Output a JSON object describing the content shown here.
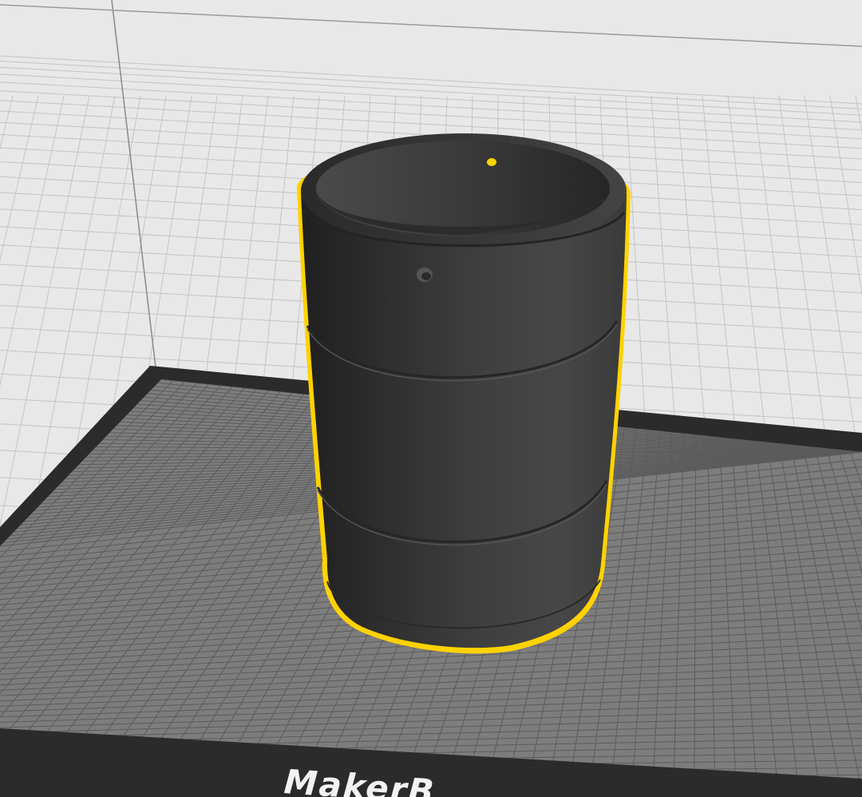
{
  "app": {
    "view": "3d-build-preview"
  },
  "build_plate": {
    "brand_text": "MakerB",
    "surface_color": "#7d7d7d",
    "frame_color": "#2b2b2b",
    "grid_color": "#5c5c5c"
  },
  "environment": {
    "background_color": "#e8e8e8",
    "grid_color": "#c4c4c4"
  },
  "model": {
    "shape": "barrel",
    "selected": true,
    "selection_color": "#ffd200",
    "body_color": "#3c3c3c"
  }
}
